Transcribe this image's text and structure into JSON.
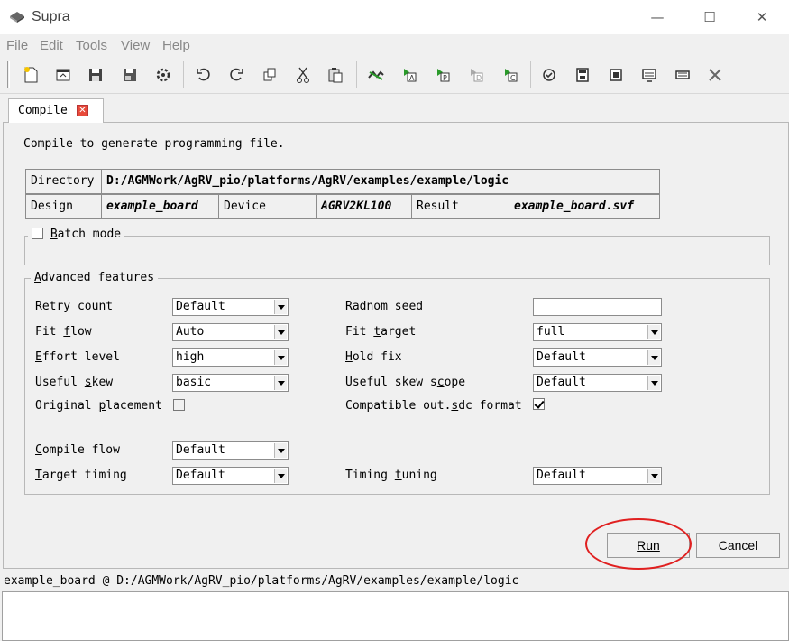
{
  "window": {
    "title": "Supra",
    "controls": {
      "minimize": "—",
      "maximize": "☐",
      "close": "✕"
    }
  },
  "menu": [
    "File",
    "Edit",
    "Tools",
    "View",
    "Help"
  ],
  "toolbar_icons": [
    "new-file-icon",
    "open-project-icon",
    "save-icon",
    "save-as-icon",
    "settings-icon",
    "undo-icon",
    "redo-icon",
    "copy-icon",
    "cut-icon",
    "paste-icon",
    "compile-icon",
    "step-a-icon",
    "step-p-icon",
    "step-d-icon",
    "step-c-icon",
    "check-icon",
    "program-icon",
    "chip-icon",
    "monitor-icon",
    "device-icon",
    "stop-icon"
  ],
  "tab": {
    "label": "Compile",
    "close_glyph": "✕"
  },
  "intro": "Compile to generate programming file.",
  "info": {
    "directory_label": "Directory",
    "directory_value": "D:/AGMWork/AgRV_pio/platforms/AgRV/examples/example/logic",
    "design_label": "Design",
    "design_value": "example_board",
    "device_label": "Device",
    "device_value": "AGRV2KL100",
    "result_label": "Result",
    "result_value": "example_board.svf"
  },
  "batch_mode": {
    "label": "Batch mode",
    "checked": false
  },
  "advanced": {
    "title": "Advanced features",
    "retry_count": {
      "label": "Retry count",
      "value": "Default"
    },
    "random_seed": {
      "label": "Radnom seed",
      "value": ""
    },
    "fit_flow": {
      "label": "Fit flow",
      "value": "Auto"
    },
    "fit_target": {
      "label": "Fit target",
      "value": "full"
    },
    "effort_level": {
      "label": "Effort level",
      "value": "high"
    },
    "hold_fix": {
      "label": "Hold fix",
      "value": "Default"
    },
    "useful_skew": {
      "label": "Useful skew",
      "value": "basic"
    },
    "useful_skew_scope": {
      "label": "Useful skew scope",
      "value": "Default"
    },
    "original_placement": {
      "label": "Original placement",
      "checked": false
    },
    "compatible_sdc": {
      "label": "Compatible out.sdc format",
      "checked": true
    },
    "compile_flow": {
      "label": "Compile flow",
      "value": "Default"
    },
    "target_timing": {
      "label": "Target timing",
      "value": "Default"
    },
    "timing_tuning": {
      "label": "Timing tuning",
      "value": "Default"
    }
  },
  "buttons": {
    "run": "Run",
    "cancel": "Cancel"
  },
  "status_path": "example_board @ D:/AGMWork/AgRV_pio/platforms/AgRV/examples/example/logic",
  "colors": {
    "highlight_ring": "#e02020",
    "tab_close": "#e84a3a"
  }
}
